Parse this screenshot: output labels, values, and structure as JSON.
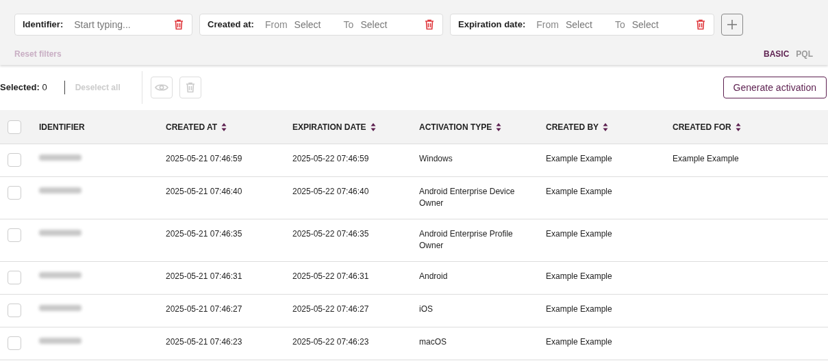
{
  "filters": [
    {
      "kind": "text",
      "label": "Identifier:",
      "placeholder": "Start typing..."
    },
    {
      "kind": "range",
      "label": "Created at:",
      "from_label": "From",
      "from_value": "Select",
      "to_label": "To",
      "to_value": "Select"
    },
    {
      "kind": "range",
      "label": "Expiration date:",
      "from_label": "From",
      "from_value": "Select",
      "to_label": "To",
      "to_value": "Select"
    }
  ],
  "reset_filters": {
    "label": "Reset filters",
    "disabled": true
  },
  "modes": [
    {
      "label": "BASIC",
      "selected": true
    },
    {
      "label": "PQL",
      "selected": false
    }
  ],
  "toolbar": {
    "selected_label": "Selected:",
    "selected_count": "0",
    "deselect_all": {
      "label": "Deselect all",
      "disabled": true
    },
    "actions_disabled": true,
    "generate_button": "Generate activation"
  },
  "table": {
    "select_all_checked": false,
    "columns": [
      {
        "label": "IDENTIFIER"
      },
      {
        "label": "CREATED AT",
        "sortable": true
      },
      {
        "label": "EXPIRATION DATE",
        "sortable": true
      },
      {
        "label": "ACTIVATION TYPE",
        "sortable": true
      },
      {
        "label": "CREATED BY",
        "sortable": true
      },
      {
        "label": "CREATED FOR",
        "sortable": true
      }
    ],
    "rows": [
      {
        "checked": false,
        "created_at": "2025-05-21 07:46:59",
        "expiration_date": "2025-05-22 07:46:59",
        "activation_type": "Windows",
        "created_by": "Example Example",
        "created_for": "Example Example"
      },
      {
        "checked": false,
        "created_at": "2025-05-21 07:46:40",
        "expiration_date": "2025-05-22 07:46:40",
        "activation_type": "Android Enterprise Device Owner",
        "created_by": "Example Example"
      },
      {
        "checked": false,
        "created_at": "2025-05-21 07:46:35",
        "expiration_date": "2025-05-22 07:46:35",
        "activation_type": "Android Enterprise Profile Owner",
        "created_by": "Example Example"
      },
      {
        "checked": false,
        "created_at": "2025-05-21 07:46:31",
        "expiration_date": "2025-05-22 07:46:31",
        "activation_type": "Android",
        "created_by": "Example Example"
      },
      {
        "checked": false,
        "created_at": "2025-05-21 07:46:27",
        "expiration_date": "2025-05-22 07:46:27",
        "activation_type": "iOS",
        "created_by": "Example Example"
      },
      {
        "checked": false,
        "created_at": "2025-05-21 07:46:23",
        "expiration_date": "2025-05-22 07:46:23",
        "activation_type": "macOS",
        "created_by": "Example Example"
      }
    ]
  }
}
